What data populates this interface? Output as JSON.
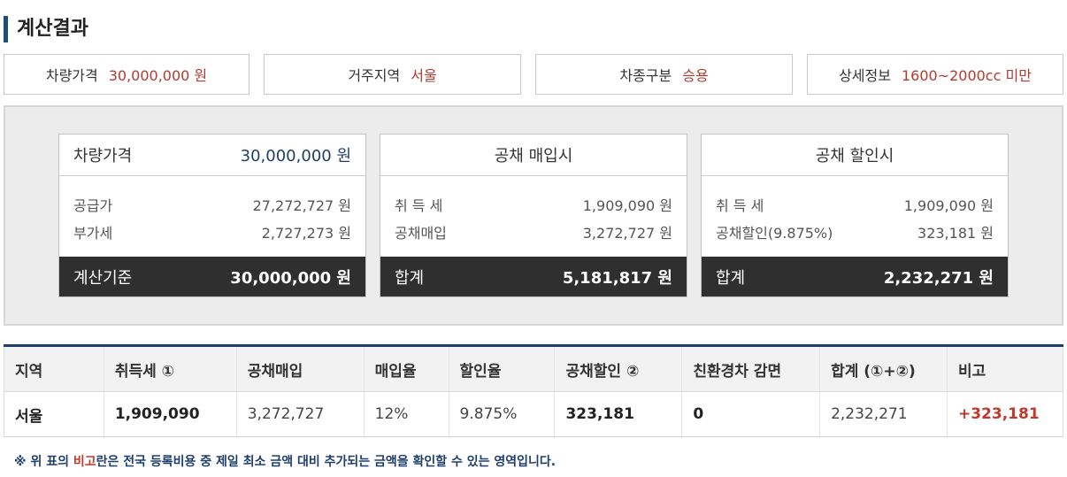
{
  "section_title": "계산결과",
  "summary": [
    {
      "label": "차량가격",
      "value": "30,000,000 원"
    },
    {
      "label": "거주지역",
      "value": "서울"
    },
    {
      "label": "차종구분",
      "value": "승용"
    },
    {
      "label": "상세정보",
      "value": "1600~2000cc 미만"
    }
  ],
  "cards": {
    "price": {
      "head_label": "차량가격",
      "head_value": "30,000,000 원",
      "rows": [
        {
          "label": "공급가",
          "value": "27,272,727 원"
        },
        {
          "label": "부가세",
          "value": "2,727,273 원"
        }
      ],
      "foot_label": "계산기준",
      "foot_value": "30,000,000 원"
    },
    "bond_purchase": {
      "title": "공채 매입시",
      "rows": [
        {
          "label": "취 득 세",
          "value": "1,909,090 원"
        },
        {
          "label": "공채매입",
          "value": "3,272,727 원"
        }
      ],
      "foot_label": "합계",
      "foot_value": "5,181,817 원"
    },
    "bond_discount": {
      "title": "공채 할인시",
      "rows": [
        {
          "label": "취 득 세",
          "value": "1,909,090 원"
        },
        {
          "label": "공채할인(9.875%)",
          "value": "323,181 원"
        }
      ],
      "foot_label": "합계",
      "foot_value": "2,232,271 원"
    }
  },
  "table": {
    "headers": [
      "지역",
      "취득세 ①",
      "공채매입",
      "매입율",
      "할인율",
      "공채할인 ②",
      "친환경차 감면",
      "합계 (①+②)",
      "비고"
    ],
    "row": [
      "서울",
      "1,909,090",
      "3,272,727",
      "12%",
      "9.875%",
      "323,181",
      "0",
      "2,232,271",
      "+323,181"
    ]
  },
  "note": {
    "prefix": "※ 위 표의 ",
    "highlight": "비고",
    "suffix": "란은 전국 등록비용 중 제일 최소 금액 대비 추가되는 금액을 확인할 수 있는 영역입니다."
  },
  "colors": {
    "accent": "#1f3f6b",
    "value_red": "#b23a2e",
    "dark_footer": "#2f2f2f"
  }
}
